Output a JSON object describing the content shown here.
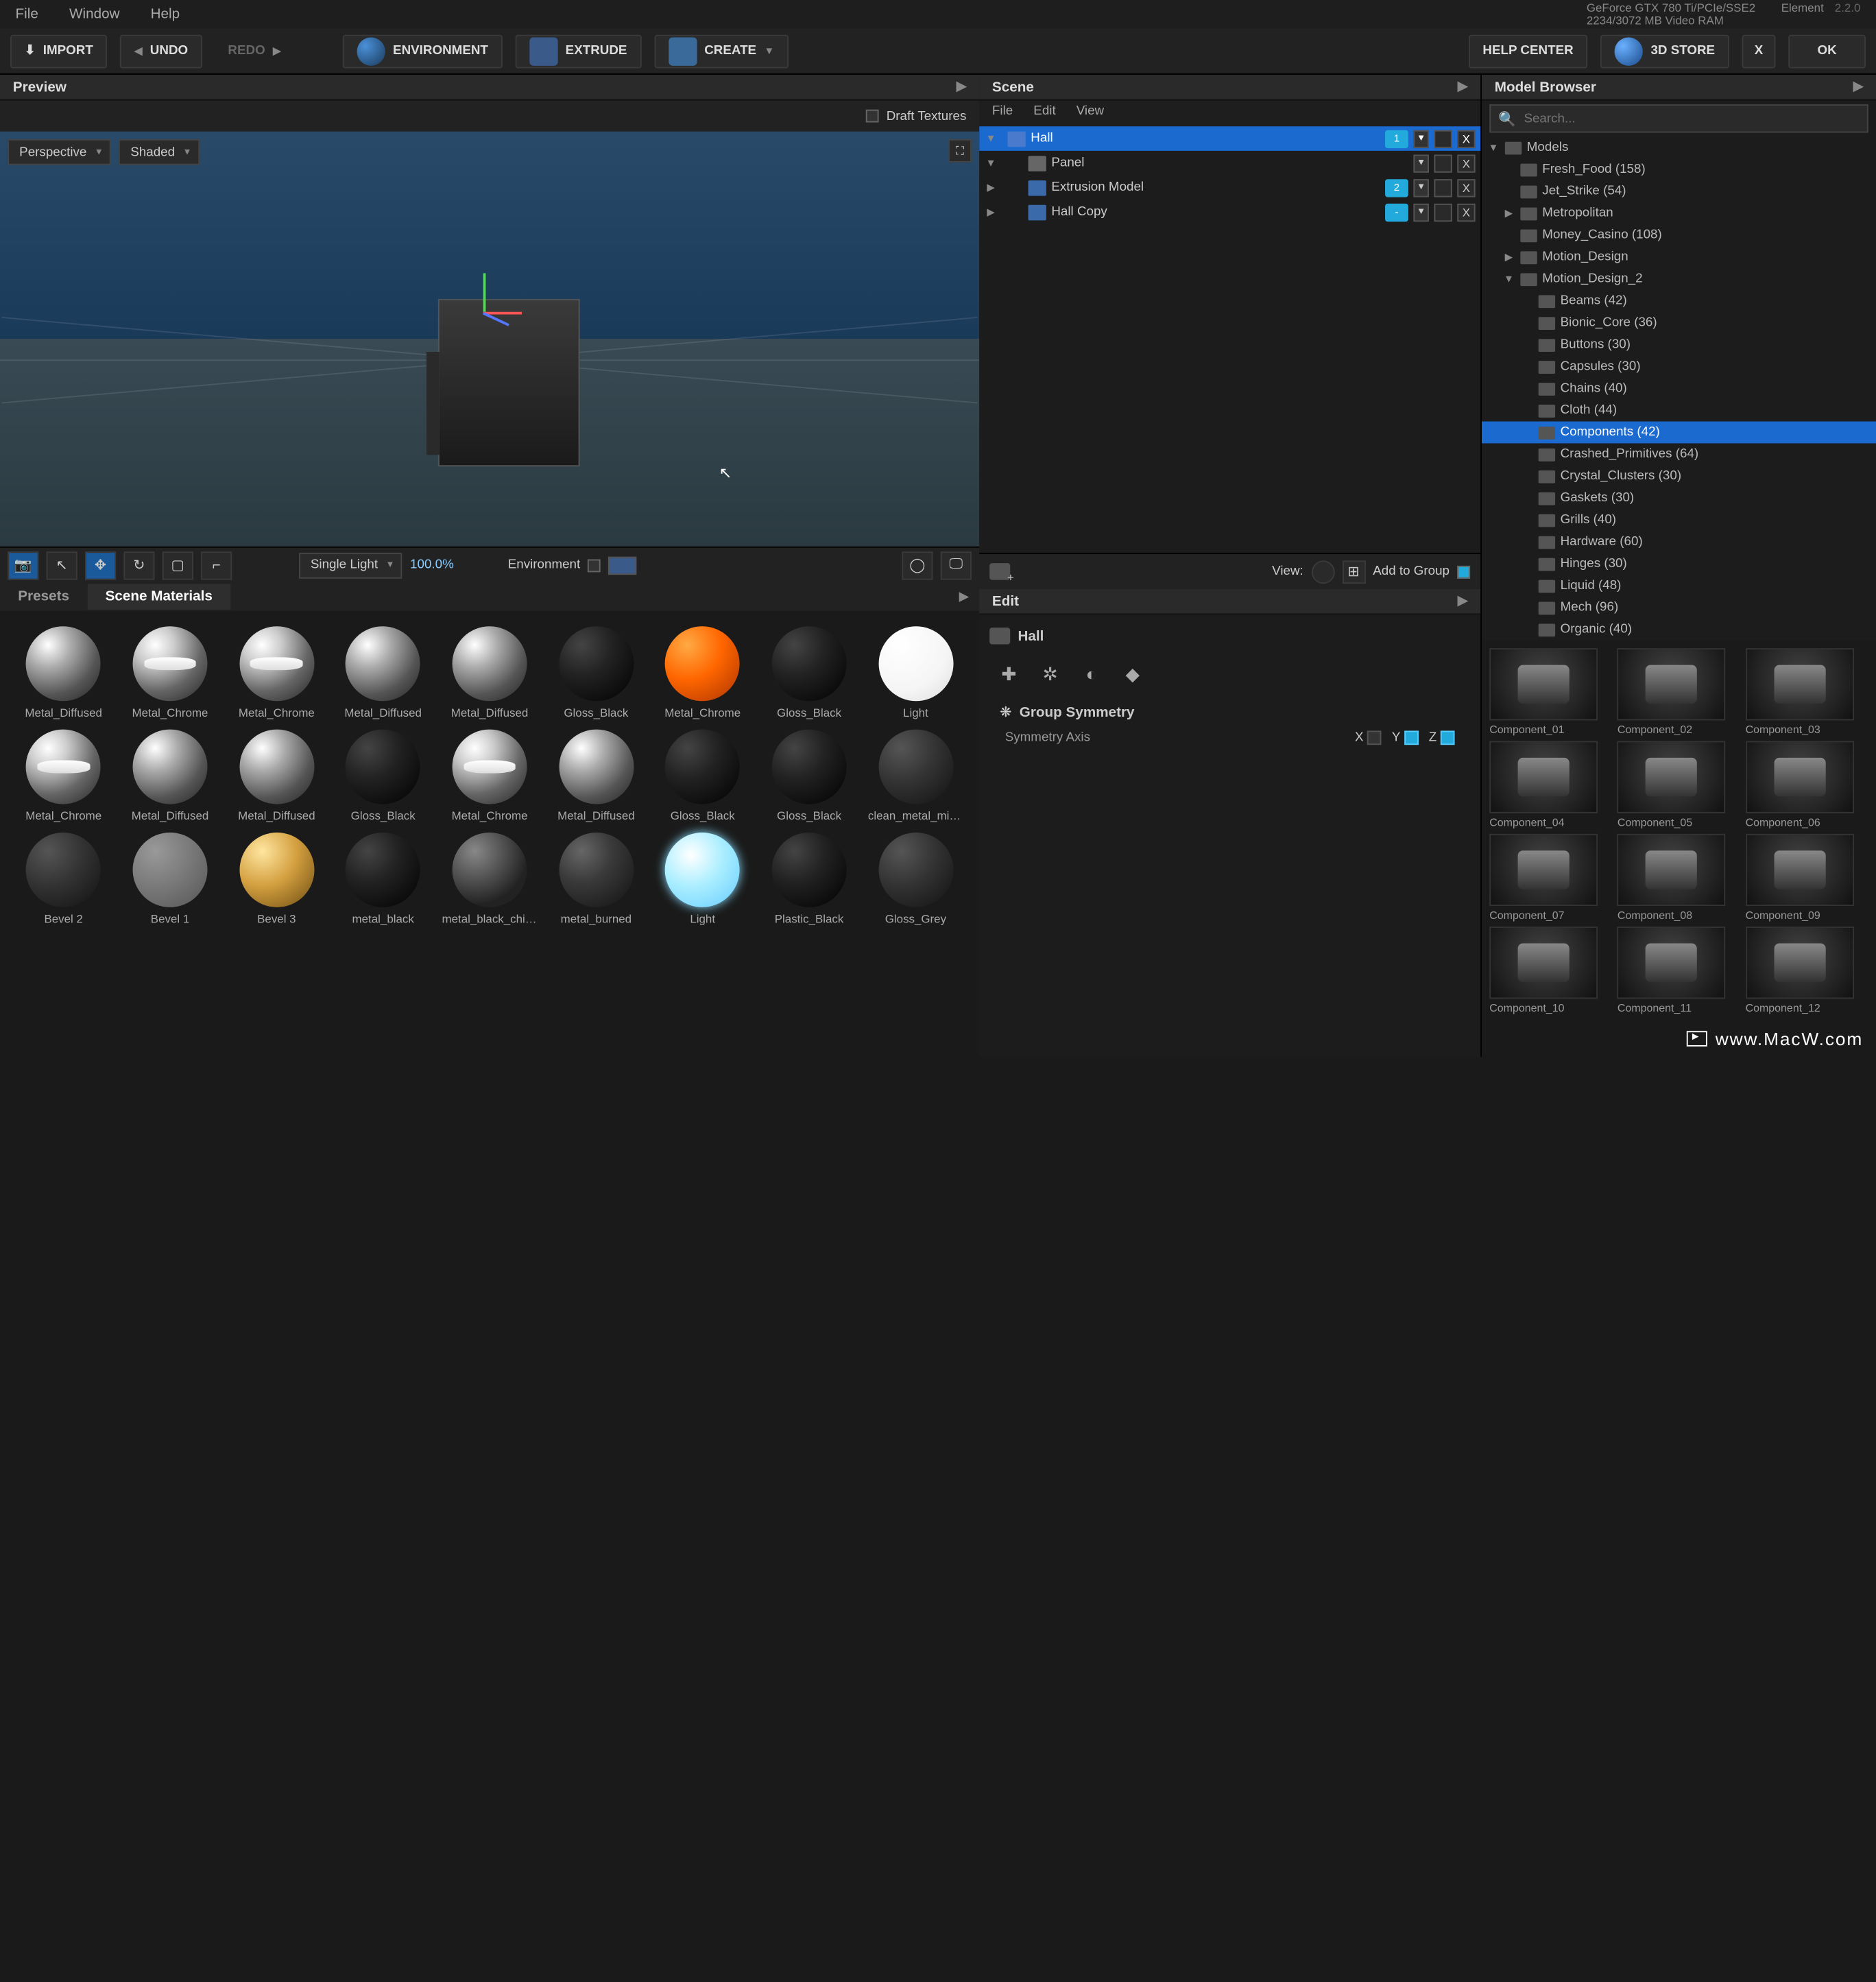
{
  "menubar": {
    "file": "File",
    "window": "Window",
    "help": "Help",
    "gpu": "GeForce GTX 780 Ti/PCIe/SSE2",
    "vram": "2234/3072 MB Video RAM",
    "element": "Element",
    "version": "2.2.0"
  },
  "toolbar": {
    "import": "IMPORT",
    "undo": "UNDO",
    "redo": "REDO",
    "environment": "ENVIRONMENT",
    "extrude": "EXTRUDE",
    "create": "CREATE",
    "help_center": "HELP CENTER",
    "store": "3D STORE",
    "close": "X",
    "ok": "OK"
  },
  "preview": {
    "title": "Preview",
    "draft_textures": "Draft Textures",
    "camera": "Perspective",
    "shading": "Shaded",
    "light_mode": "Single Light",
    "light_value": "100.0%",
    "env_label": "Environment"
  },
  "scene": {
    "title": "Scene",
    "menu": {
      "file": "File",
      "edit": "Edit",
      "view": "View"
    },
    "items": [
      {
        "name": "Hall",
        "selected": true,
        "badge": "1",
        "has_dd": true
      },
      {
        "name": "Panel",
        "badge": "",
        "has_dd": true
      },
      {
        "name": "Extrusion Model",
        "badge": "2",
        "has_dd": true
      },
      {
        "name": "Hall Copy",
        "badge": "-",
        "has_dd": true
      }
    ],
    "view_label": "View:",
    "add_to_group": "Add to Group"
  },
  "edit": {
    "title": "Edit",
    "object": "Hall",
    "group_symmetry": "Group Symmetry",
    "symmetry_axis": "Symmetry Axis",
    "x": "X",
    "y": "Y",
    "z": "Z"
  },
  "browser": {
    "title": "Model Browser",
    "search_placeholder": "Search...",
    "tree": [
      {
        "l": 0,
        "name": "Models",
        "exp": true
      },
      {
        "l": 1,
        "name": "Fresh_Food (158)"
      },
      {
        "l": 1,
        "name": "Jet_Strike (54)"
      },
      {
        "l": 1,
        "name": "Metropolitan",
        "exp": false,
        "arrow": true
      },
      {
        "l": 1,
        "name": "Money_Casino (108)"
      },
      {
        "l": 1,
        "name": "Motion_Design",
        "exp": false,
        "arrow": true
      },
      {
        "l": 1,
        "name": "Motion_Design_2",
        "exp": true,
        "arrow": true
      },
      {
        "l": 2,
        "name": "Beams (42)"
      },
      {
        "l": 2,
        "name": "Bionic_Core (36)"
      },
      {
        "l": 2,
        "name": "Buttons (30)"
      },
      {
        "l": 2,
        "name": "Capsules (30)"
      },
      {
        "l": 2,
        "name": "Chains (40)"
      },
      {
        "l": 2,
        "name": "Cloth (44)"
      },
      {
        "l": 2,
        "name": "Components (42)",
        "selected": true
      },
      {
        "l": 2,
        "name": "Crashed_Primitives (64)"
      },
      {
        "l": 2,
        "name": "Crystal_Clusters (30)"
      },
      {
        "l": 2,
        "name": "Gaskets (30)"
      },
      {
        "l": 2,
        "name": "Grills (40)"
      },
      {
        "l": 2,
        "name": "Hardware (60)"
      },
      {
        "l": 2,
        "name": "Hinges (30)"
      },
      {
        "l": 2,
        "name": "Liquid (48)"
      },
      {
        "l": 2,
        "name": "Mech (96)"
      },
      {
        "l": 2,
        "name": "Organic (40)"
      }
    ],
    "components": [
      "Component_01",
      "Component_02",
      "Component_03",
      "Component_04",
      "Component_05",
      "Component_06",
      "Component_07",
      "Component_08",
      "Component_09",
      "Component_10",
      "Component_11",
      "Component_12"
    ]
  },
  "materials": {
    "tab_presets": "Presets",
    "tab_scene": "Scene Materials",
    "items": [
      {
        "name": "Metal_Diffused",
        "cls": "sphere-silver"
      },
      {
        "name": "Metal_Chrome",
        "cls": "sphere-silver-line"
      },
      {
        "name": "Metal_Chrome",
        "cls": "sphere-silver-line"
      },
      {
        "name": "Metal_Diffused",
        "cls": "sphere-silver"
      },
      {
        "name": "Metal_Diffused",
        "cls": "sphere-silver"
      },
      {
        "name": "Gloss_Black",
        "cls": "sphere-black"
      },
      {
        "name": "Metal_Chrome",
        "cls": "sphere-orange"
      },
      {
        "name": "Gloss_Black",
        "cls": "sphere-black"
      },
      {
        "name": "Light",
        "cls": "sphere-white"
      },
      {
        "name": "Metal_Chrome",
        "cls": "sphere-silver-line"
      },
      {
        "name": "Metal_Diffused",
        "cls": "sphere-silver"
      },
      {
        "name": "Metal_Diffused",
        "cls": "sphere-silver"
      },
      {
        "name": "Gloss_Black",
        "cls": "sphere-black"
      },
      {
        "name": "Metal_Chrome",
        "cls": "sphere-silver-line"
      },
      {
        "name": "Metal_Diffused",
        "cls": "sphere-silver"
      },
      {
        "name": "Gloss_Black",
        "cls": "sphere-black"
      },
      {
        "name": "Gloss_Black",
        "cls": "sphere-black"
      },
      {
        "name": "clean_metal_milita",
        "cls": "sphere-dark-grey"
      },
      {
        "name": "Bevel 2",
        "cls": "sphere-dark-grey"
      },
      {
        "name": "Bevel 1",
        "cls": "sphere-grey-flat"
      },
      {
        "name": "Bevel 3",
        "cls": "sphere-gold"
      },
      {
        "name": "metal_black",
        "cls": "sphere-black"
      },
      {
        "name": "metal_black_chips",
        "cls": "sphere-chips"
      },
      {
        "name": "metal_burned",
        "cls": "sphere-burned"
      },
      {
        "name": "Light",
        "cls": "sphere-cyan"
      },
      {
        "name": "Plastic_Black",
        "cls": "sphere-black"
      },
      {
        "name": "Gloss_Grey",
        "cls": "sphere-dark-grey"
      }
    ]
  },
  "watermark": "www.MacW.com"
}
